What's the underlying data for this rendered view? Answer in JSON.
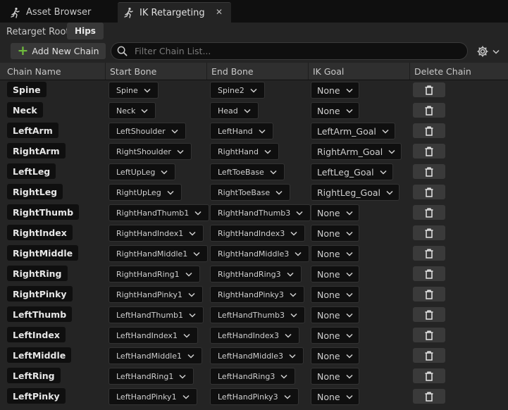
{
  "tabs": [
    {
      "label": "Asset Browser"
    },
    {
      "label": "IK Retargeting",
      "close": "✕"
    }
  ],
  "retarget_root": {
    "label": "Retarget Root:",
    "value": "Hips"
  },
  "toolbar": {
    "add_label": "Add New Chain",
    "search_placeholder": "Filter Chain List..."
  },
  "columns": [
    "Chain Name",
    "Start Bone",
    "End Bone",
    "IK Goal",
    "Delete Chain"
  ],
  "rows": [
    {
      "name": "Spine",
      "start": "Spine",
      "end": "Spine2",
      "goal": "None"
    },
    {
      "name": "Neck",
      "start": "Neck",
      "end": "Head",
      "goal": "None"
    },
    {
      "name": "LeftArm",
      "start": "LeftShoulder",
      "end": "LeftHand",
      "goal": "LeftArm_Goal"
    },
    {
      "name": "RightArm",
      "start": "RightShoulder",
      "end": "RightHand",
      "goal": "RightArm_Goal"
    },
    {
      "name": "LeftLeg",
      "start": "LeftUpLeg",
      "end": "LeftToeBase",
      "goal": "LeftLeg_Goal"
    },
    {
      "name": "RightLeg",
      "start": "RightUpLeg",
      "end": "RightToeBase",
      "goal": "RightLeg_Goal"
    },
    {
      "name": "RightThumb",
      "start": "RightHandThumb1",
      "end": "RightHandThumb3",
      "goal": "None"
    },
    {
      "name": "RightIndex",
      "start": "RightHandIndex1",
      "end": "RightHandIndex3",
      "goal": "None"
    },
    {
      "name": "RightMiddle",
      "start": "RightHandMiddle1",
      "end": "RightHandMiddle3",
      "goal": "None"
    },
    {
      "name": "RightRing",
      "start": "RightHandRing1",
      "end": "RightHandRing3",
      "goal": "None"
    },
    {
      "name": "RightPinky",
      "start": "RightHandPinky1",
      "end": "RightHandPinky3",
      "goal": "None"
    },
    {
      "name": "LeftThumb",
      "start": "LeftHandThumb1",
      "end": "LeftHandThumb3",
      "goal": "None"
    },
    {
      "name": "LeftIndex",
      "start": "LeftHandIndex1",
      "end": "LeftHandIndex3",
      "goal": "None"
    },
    {
      "name": "LeftMiddle",
      "start": "LeftHandMiddle1",
      "end": "LeftHandMiddle3",
      "goal": "None"
    },
    {
      "name": "LeftRing",
      "start": "LeftHandRing1",
      "end": "LeftHandRing3",
      "goal": "None"
    },
    {
      "name": "LeftPinky",
      "start": "LeftHandPinky1",
      "end": "LeftHandPinky3",
      "goal": "None"
    }
  ],
  "icons": {
    "tab_icon": "running-figure-icon",
    "add": "plus-icon",
    "search": "search-icon",
    "settings": "gear-icon",
    "dropdown": "chevron-down-icon",
    "delete": "trash-icon"
  },
  "colors": {
    "accent_add": "#6fbd3d",
    "panel": "#242424",
    "field": "#0f0f0f"
  }
}
